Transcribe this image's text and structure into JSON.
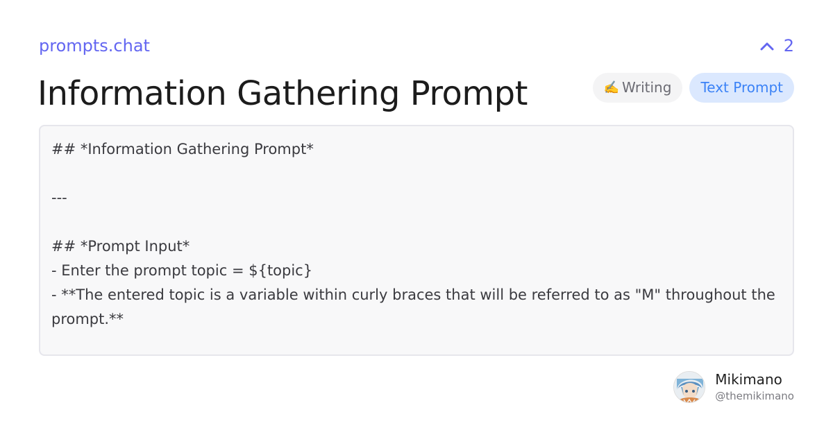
{
  "header": {
    "brand": "prompts.chat",
    "vote_count": "2"
  },
  "title": "Information Gathering Prompt",
  "tags": {
    "category_emoji": "✍️",
    "category_label": "Writing",
    "type_label": "Text Prompt"
  },
  "prompt": {
    "line_1": "## *Information Gathering Prompt*",
    "line_3": "---",
    "line_5": "## *Prompt Input*",
    "line_6": "- Enter the prompt topic = ${topic}",
    "line_7": "- **The entered topic is a variable within curly braces that will be referred to as \"M\" throughout the prompt.**"
  },
  "author": {
    "name": "Mikimano",
    "handle": "@themikimano"
  },
  "colors": {
    "accent": "#6366f1",
    "type_tag_bg": "#dbe8fe",
    "type_tag_text": "#3b82f6"
  }
}
